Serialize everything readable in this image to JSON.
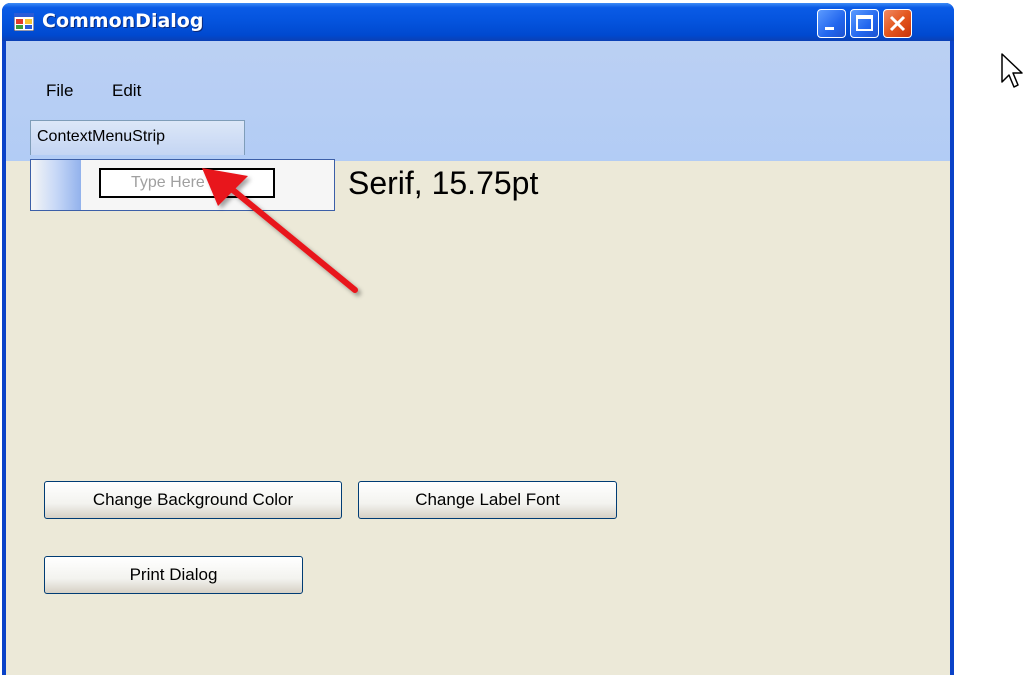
{
  "window": {
    "title": "CommonDialog",
    "title_icon": "app-window-icon",
    "controls": [
      "minimize-icon",
      "maximize-icon",
      "close-icon"
    ]
  },
  "menubar": {
    "items": [
      {
        "label": "File"
      },
      {
        "label": "Edit"
      }
    ]
  },
  "context_menu_strip": {
    "tab_label": "ContextMenuStrip",
    "type_here_placeholder": "Type Here"
  },
  "font_label": {
    "text": "Serif, 15.75pt"
  },
  "buttons": {
    "change_background_color": "Change Background Color",
    "change_label_font": "Change Label Font",
    "print_dialog": "Print Dialog"
  },
  "annotation": {
    "arrow_color": "#E8141B"
  },
  "colors": {
    "titlebar": "#0453DD",
    "menubar": "#B2CCF5",
    "client": "#ECE9D8",
    "close_button": "#E4561E"
  }
}
